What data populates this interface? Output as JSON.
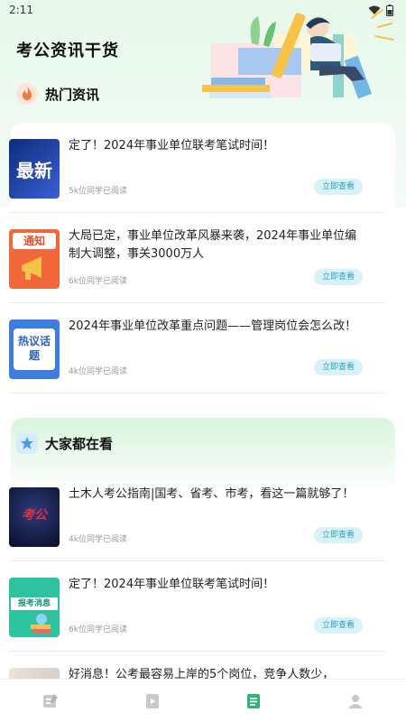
{
  "status": {
    "time": "2:11"
  },
  "app_title": "考公资讯干货",
  "section1": {
    "title": "热门资讯"
  },
  "section2": {
    "title": "大家都在看"
  },
  "read_button": "立即查看",
  "hot_news": [
    {
      "title": "定了！2024年事业单位联考笔试时间！",
      "reads": "5k位同学已阅读",
      "thumb_text": "最新"
    },
    {
      "title": "大局已定，事业单位改革风暴来袭，2024年事业单位编制大调整，事关3000万人",
      "reads": "6k位同学已阅读",
      "thumb_text": "通知"
    },
    {
      "title": "2024年事业单位改革重点问题——管理岗位会怎么改！",
      "reads": "4k位同学已阅读",
      "thumb_text": "热议话题"
    }
  ],
  "popular": [
    {
      "title": "土木人考公指南|国考、省考、市考，看这一篇就够了！",
      "reads": "4k位同学已阅读",
      "thumb_text": "考公"
    },
    {
      "title": "定了！2024年事业单位联考笔试时间！",
      "reads": "6k位同学已阅读",
      "thumb_text": "报考消息"
    },
    {
      "title": "好消息！公考最容易上岸的5个岗位，竞争人数少，"
    }
  ],
  "tabs": [
    {
      "icon": "edit-icon"
    },
    {
      "icon": "video-icon"
    },
    {
      "icon": "document-icon"
    },
    {
      "icon": "profile-icon"
    }
  ],
  "colors": {
    "accent": "#2bb673",
    "button_bg": "#d9f2f8",
    "button_text": "#2aa2c4"
  }
}
